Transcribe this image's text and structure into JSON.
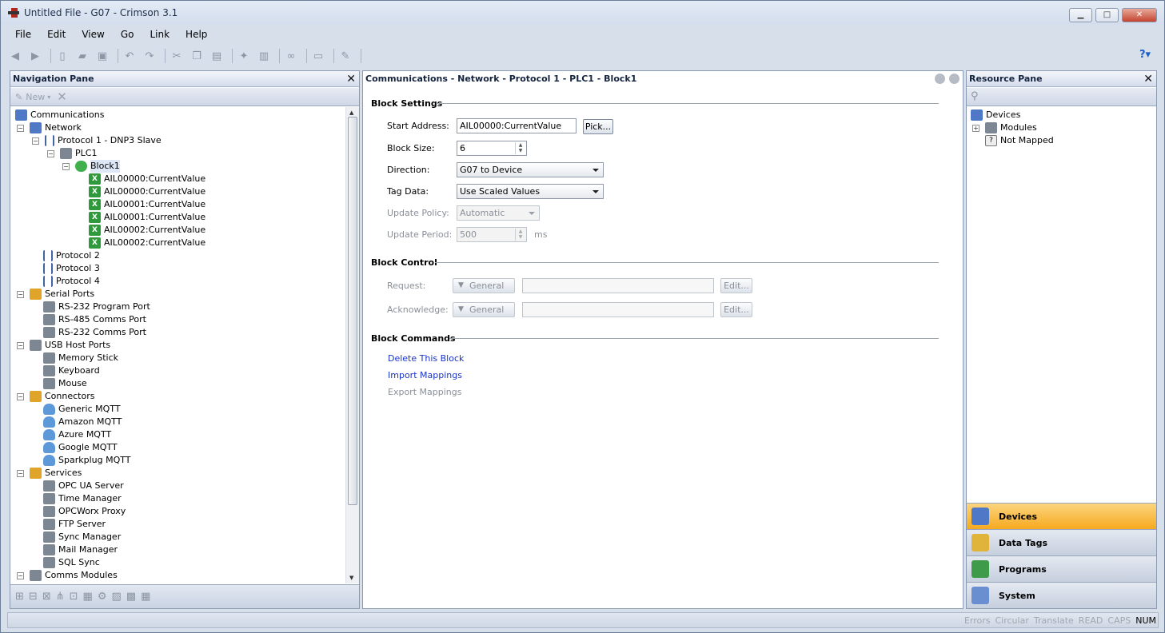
{
  "window": {
    "title": "Untitled File - G07 - Crimson 3.1"
  },
  "menu": [
    "File",
    "Edit",
    "View",
    "Go",
    "Link",
    "Help"
  ],
  "nav": {
    "title": "Navigation Pane",
    "new_label": "New",
    "tree": [
      {
        "label": "Communications",
        "icon": "comms-icon"
      },
      {
        "label": "Network",
        "icon": "network-icon"
      },
      {
        "label": "Protocol 1 - DNP3 Slave",
        "icon": "protocol-icon"
      },
      {
        "label": "PLC1",
        "icon": "plc-icon"
      },
      {
        "label": "Block1",
        "icon": "block-icon"
      },
      {
        "label": "AIL00000:CurrentValue",
        "icon": "tag-icon"
      },
      {
        "label": "AIL00000:CurrentValue",
        "icon": "tag-icon"
      },
      {
        "label": "AIL00001:CurrentValue",
        "icon": "tag-icon"
      },
      {
        "label": "AIL00001:CurrentValue",
        "icon": "tag-icon"
      },
      {
        "label": "AIL00002:CurrentValue",
        "icon": "tag-icon"
      },
      {
        "label": "AIL00002:CurrentValue",
        "icon": "tag-icon"
      },
      {
        "label": "Protocol 2",
        "icon": "protocol-icon"
      },
      {
        "label": "Protocol 3",
        "icon": "protocol-icon"
      },
      {
        "label": "Protocol 4",
        "icon": "protocol-icon"
      },
      {
        "label": "Serial Ports",
        "icon": "serial-icon"
      },
      {
        "label": "RS-232 Program Port",
        "icon": "port-icon"
      },
      {
        "label": "RS-485 Comms Port",
        "icon": "port-icon"
      },
      {
        "label": "RS-232 Comms Port",
        "icon": "port-icon"
      },
      {
        "label": "USB Host Ports",
        "icon": "usb-icon"
      },
      {
        "label": "Memory Stick",
        "icon": "memory-stick-icon"
      },
      {
        "label": "Keyboard",
        "icon": "keyboard-icon"
      },
      {
        "label": "Mouse",
        "icon": "mouse-icon"
      },
      {
        "label": "Connectors",
        "icon": "connectors-icon"
      },
      {
        "label": "Generic MQTT",
        "icon": "cloud-icon"
      },
      {
        "label": "Amazon MQTT",
        "icon": "cloud-icon"
      },
      {
        "label": "Azure MQTT",
        "icon": "cloud-icon"
      },
      {
        "label": "Google MQTT",
        "icon": "cloud-icon"
      },
      {
        "label": "Sparkplug MQTT",
        "icon": "cloud-icon"
      },
      {
        "label": "Services",
        "icon": "services-icon"
      },
      {
        "label": "OPC UA Server",
        "icon": "opc-icon"
      },
      {
        "label": "Time Manager",
        "icon": "clock-icon"
      },
      {
        "label": "OPCWorx Proxy",
        "icon": "proxy-icon"
      },
      {
        "label": "FTP Server",
        "icon": "ftp-icon"
      },
      {
        "label": "Sync Manager",
        "icon": "sync-icon"
      },
      {
        "label": "Mail Manager",
        "icon": "mail-icon"
      },
      {
        "label": "SQL Sync",
        "icon": "sql-icon"
      },
      {
        "label": "Comms Modules",
        "icon": "modules-icon"
      }
    ]
  },
  "center": {
    "breadcrumb": "Communications - Network - Protocol 1 - PLC1 - Block1",
    "block_settings": {
      "heading": "Block Settings",
      "start_address_label": "Start Address:",
      "start_address_value": "AIL00000:CurrentValue",
      "pick_label": "Pick...",
      "block_size_label": "Block Size:",
      "block_size_value": "6",
      "direction_label": "Direction:",
      "direction_value": "G07 to Device",
      "tag_data_label": "Tag Data:",
      "tag_data_value": "Use Scaled Values",
      "update_policy_label": "Update Policy:",
      "update_policy_value": "Automatic",
      "update_period_label": "Update Period:",
      "update_period_value": "500",
      "update_period_unit": "ms"
    },
    "block_control": {
      "heading": "Block Control",
      "request_label": "Request:",
      "acknowledge_label": "Acknowledge:",
      "general_label": "General",
      "edit_label": "Edit..."
    },
    "block_commands": {
      "heading": "Block Commands",
      "delete": "Delete This Block",
      "import": "Import Mappings",
      "export": "Export Mappings"
    }
  },
  "resource": {
    "title": "Resource Pane",
    "tree": [
      "Devices",
      "Modules",
      "Not Mapped"
    ],
    "tabs": [
      "Devices",
      "Data Tags",
      "Programs",
      "System"
    ]
  },
  "status": [
    "Errors",
    "Circular",
    "Translate",
    "READ",
    "CAPS",
    "NUM"
  ],
  "colors": {
    "accent": "#f6a91f",
    "link": "#1a33c9",
    "tag_green": "#2f9a3b"
  }
}
